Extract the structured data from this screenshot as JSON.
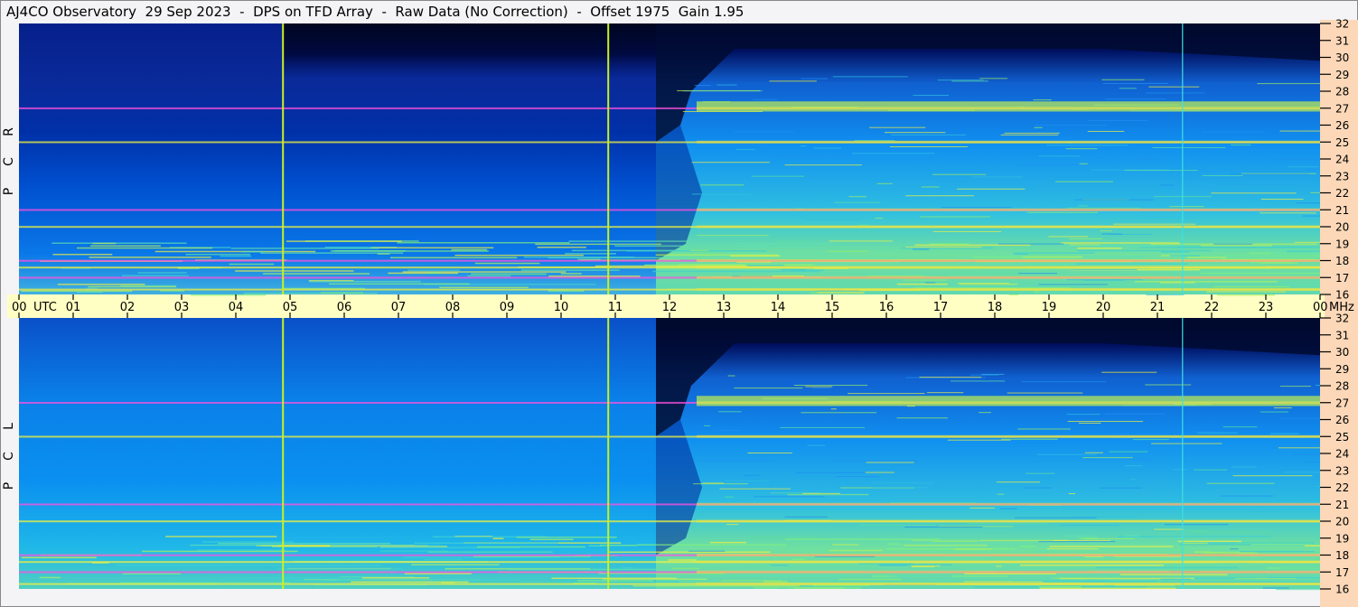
{
  "title": "AJ4CO Observatory  29 Sep 2023  -  DPS on TFD Array  -  Raw Data (No Correction)  -  Offset 1975  Gain 1.95",
  "chart_data": {
    "type": "heatmap",
    "title": "AJ4CO Observatory  29 Sep 2023  -  DPS on TFD Array  -  Raw Data (No Correction)  -  Offset 1975  Gain 1.95",
    "xlabel": "UTC",
    "ylabel": "MHz",
    "x_ticks": [
      "00",
      "01",
      "02",
      "03",
      "04",
      "05",
      "06",
      "07",
      "08",
      "09",
      "10",
      "11",
      "12",
      "13",
      "14",
      "15",
      "16",
      "17",
      "18",
      "19",
      "20",
      "21",
      "22",
      "23",
      "00"
    ],
    "xlim_hours": [
      0,
      24
    ],
    "y_ticks": [
      "32",
      "31",
      "30",
      "29",
      "28",
      "27",
      "26",
      "25",
      "24",
      "23",
      "22",
      "21",
      "20",
      "19",
      "18",
      "17",
      "16"
    ],
    "ylim_mhz": [
      16,
      32
    ],
    "panels": [
      {
        "name": "RCP",
        "label_letters": [
          "R",
          "C",
          "P"
        ]
      },
      {
        "name": "LCP",
        "label_letters": [
          "L",
          "C",
          "P"
        ]
      }
    ],
    "vertical_markers_utc_hours": [
      4.87,
      10.87
    ],
    "interference_line_utc_hours": 21.45,
    "data_gap_end_utc_hours": 11.75,
    "rfi_lines_mhz": [
      27.0,
      25.0,
      21.0,
      20.0,
      18.0,
      17.6,
      17.0,
      16.3
    ],
    "colormap": [
      "#000020",
      "#001070",
      "#0040d0",
      "#0090f0",
      "#30d0d0",
      "#90f070",
      "#f0f040",
      "#ff40ff"
    ]
  }
}
